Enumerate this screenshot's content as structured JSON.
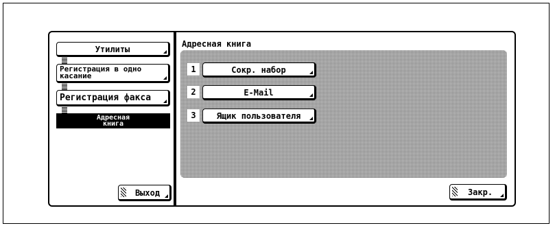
{
  "left_nav": {
    "utility_label": "Утилиты",
    "onetouch_label": "Регистрация в одно касание",
    "fax_label": "Регистрация факса",
    "address_book_label": "Адресная книга",
    "exit_label": "Выход"
  },
  "main": {
    "title": "Адресная книга",
    "items": [
      {
        "number": "1",
        "label": "Сокр. набор"
      },
      {
        "number": "2",
        "label": "E-Mail"
      },
      {
        "number": "3",
        "label": "Ящик пользователя"
      }
    ],
    "close_label": "Закр."
  }
}
